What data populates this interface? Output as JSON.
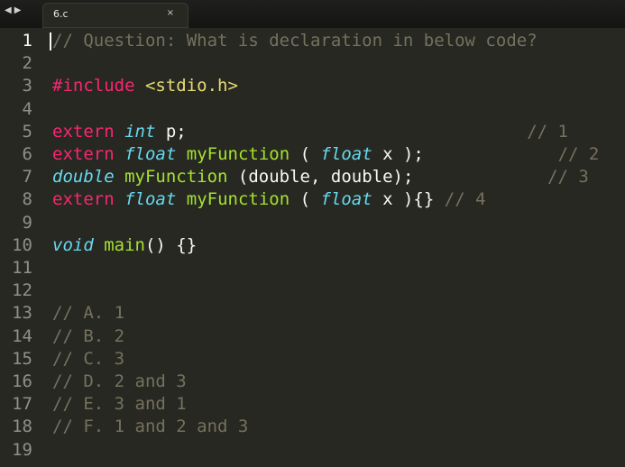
{
  "tabbar": {
    "back_arrow": "◀",
    "forward_arrow": "▶",
    "tab_label": "6.c",
    "tab_close": "×"
  },
  "lines": [
    {
      "n": "1",
      "segs": [
        {
          "t": "// Question: What is declaration in below code?",
          "c": "cm"
        }
      ]
    },
    {
      "n": "2",
      "segs": []
    },
    {
      "n": "3",
      "segs": [
        {
          "t": "#include",
          "c": "kw"
        },
        {
          "t": " ",
          "c": "pl"
        },
        {
          "t": "<stdio.h>",
          "c": "str"
        }
      ]
    },
    {
      "n": "4",
      "segs": []
    },
    {
      "n": "5",
      "segs": [
        {
          "t": "extern",
          "c": "kw"
        },
        {
          "t": " ",
          "c": "pl"
        },
        {
          "t": "int",
          "c": "ty"
        },
        {
          "t": " p;                                 ",
          "c": "pl"
        },
        {
          "t": "// 1",
          "c": "cm"
        }
      ]
    },
    {
      "n": "6",
      "segs": [
        {
          "t": "extern",
          "c": "kw"
        },
        {
          "t": " ",
          "c": "pl"
        },
        {
          "t": "float",
          "c": "ty"
        },
        {
          "t": " ",
          "c": "pl"
        },
        {
          "t": "myFunction",
          "c": "fn"
        },
        {
          "t": " ( ",
          "c": "pl"
        },
        {
          "t": "float",
          "c": "ty"
        },
        {
          "t": " x );             ",
          "c": "pl"
        },
        {
          "t": "// 2",
          "c": "cm"
        }
      ]
    },
    {
      "n": "7",
      "segs": [
        {
          "t": "double",
          "c": "ty"
        },
        {
          "t": " ",
          "c": "pl"
        },
        {
          "t": "myFunction",
          "c": "fn"
        },
        {
          "t": " (double, double);             ",
          "c": "pl"
        },
        {
          "t": "// 3",
          "c": "cm"
        }
      ]
    },
    {
      "n": "8",
      "segs": [
        {
          "t": "extern",
          "c": "kw"
        },
        {
          "t": " ",
          "c": "pl"
        },
        {
          "t": "float",
          "c": "ty"
        },
        {
          "t": " ",
          "c": "pl"
        },
        {
          "t": "myFunction",
          "c": "fn"
        },
        {
          "t": " ( ",
          "c": "pl"
        },
        {
          "t": "float",
          "c": "ty"
        },
        {
          "t": " x ){} ",
          "c": "pl"
        },
        {
          "t": "// 4",
          "c": "cm"
        }
      ]
    },
    {
      "n": "9",
      "segs": []
    },
    {
      "n": "10",
      "segs": [
        {
          "t": "void",
          "c": "ty"
        },
        {
          "t": " ",
          "c": "pl"
        },
        {
          "t": "main",
          "c": "fn"
        },
        {
          "t": "() {}",
          "c": "pl"
        }
      ]
    },
    {
      "n": "11",
      "segs": []
    },
    {
      "n": "12",
      "segs": []
    },
    {
      "n": "13",
      "segs": [
        {
          "t": "// A. 1",
          "c": "cm"
        }
      ]
    },
    {
      "n": "14",
      "segs": [
        {
          "t": "// B. 2",
          "c": "cm"
        }
      ]
    },
    {
      "n": "15",
      "segs": [
        {
          "t": "// C. 3",
          "c": "cm"
        }
      ]
    },
    {
      "n": "16",
      "segs": [
        {
          "t": "// D. 2 and 3",
          "c": "cm"
        }
      ]
    },
    {
      "n": "17",
      "segs": [
        {
          "t": "// E. 3 and 1",
          "c": "cm"
        }
      ]
    },
    {
      "n": "18",
      "segs": [
        {
          "t": "// F. 1 and 2 and 3",
          "c": "cm"
        }
      ]
    },
    {
      "n": "19",
      "segs": []
    }
  ],
  "colors": {
    "background": "#272822",
    "keyword": "#f92672",
    "type": "#66d9ef",
    "function": "#a6e22e",
    "string": "#e6db74",
    "comment": "#75715e",
    "text": "#f8f8f2"
  }
}
